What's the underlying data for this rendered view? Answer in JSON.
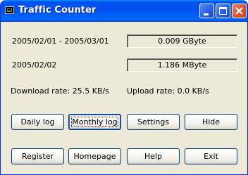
{
  "window": {
    "title": "Traffic Counter",
    "icons": [
      "app-monitor-icon",
      "minimize-icon",
      "maximize-icon",
      "close-icon"
    ]
  },
  "stats": {
    "period_label": "2005/02/01 - 2005/03/01",
    "period_value": "0.009 GByte",
    "day_label": "2005/02/02",
    "day_value": "1.186 MByte",
    "download_rate": "Download rate: 25.5 KB/s",
    "upload_rate": "Upload rate: 0.0 KB/s"
  },
  "buttons_row1": {
    "daily_log": "Daily log",
    "monthly_log": "Monthly log",
    "settings": "Settings",
    "hide": "Hide"
  },
  "buttons_row2": {
    "register": "Register",
    "homepage": "Homepage",
    "help": "Help",
    "exit": "Exit"
  },
  "colors": {
    "titlebar": "#0053ee",
    "close_button": "#d75a38",
    "face": "#ece9d8"
  }
}
